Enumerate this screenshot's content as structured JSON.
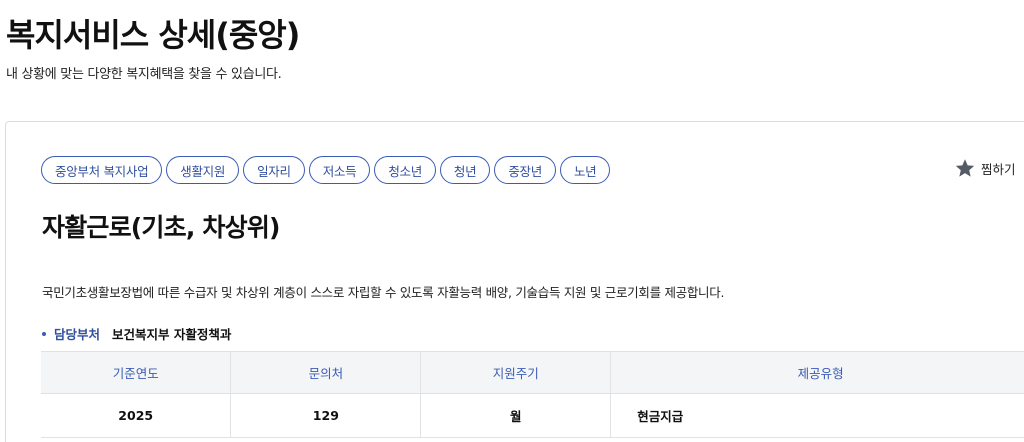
{
  "header": {
    "title": "복지서비스 상세(중앙)",
    "subtitle": "내 상황에 맞는 다양한 복지혜택을 찾을 수 있습니다."
  },
  "service": {
    "tags": [
      "중앙부처 복지사업",
      "생활지원",
      "일자리",
      "저소득",
      "청소년",
      "청년",
      "중장년",
      "노년"
    ],
    "favorite_label": "찜하기",
    "title": "자활근로(기초, 차상위)",
    "description": "국민기초생활보장법에 따른 수급자 및 차상위 계층이 스스로 자립할 수 있도록 자활능력 배양, 기술습득 지원 및 근로기회를 제공합니다.",
    "department": {
      "label": "담당부처",
      "value": "보건복지부 자활정책과"
    },
    "table": {
      "headers": [
        "기준연도",
        "문의처",
        "지원주기",
        "제공유형"
      ],
      "row": [
        "2025",
        "129",
        "월",
        "현금지급"
      ]
    }
  },
  "colors": {
    "accent": "#3b5bb5",
    "header_bg": "#f4f5f7",
    "star": "#555b66"
  },
  "icons": {
    "favorite": "star-icon",
    "bullet": "bullet-dot-icon"
  }
}
